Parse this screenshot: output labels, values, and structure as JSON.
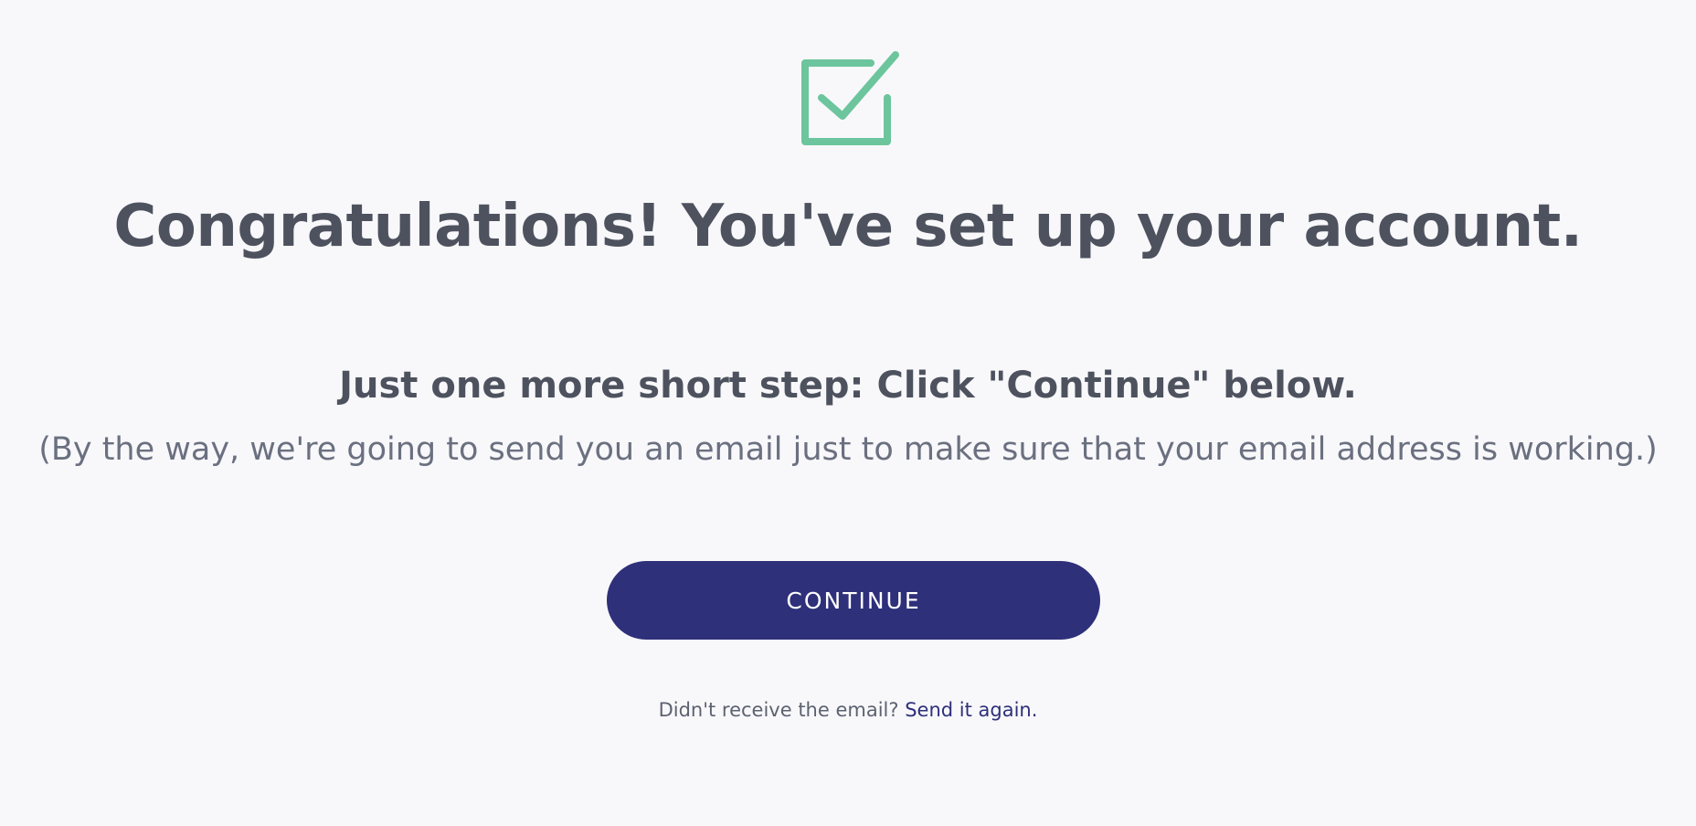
{
  "icon": "checkbox-checked-icon",
  "colors": {
    "background": "#f8f8fb",
    "accent_green": "#6cc59c",
    "primary_button": "#2e307a",
    "heading_text": "#4d525e",
    "link": "#2e307a"
  },
  "headline": "Congratulations! You've set up your account.",
  "step_text": "Just one more short step: Click \"Continue\" below.",
  "note_text": "(By the way, we're going to send you an email just to make sure that your email address is working.)",
  "continue_label": "CONTINUE",
  "resend": {
    "prompt": "Didn't receive the email?",
    "link_label": "Send it again."
  }
}
